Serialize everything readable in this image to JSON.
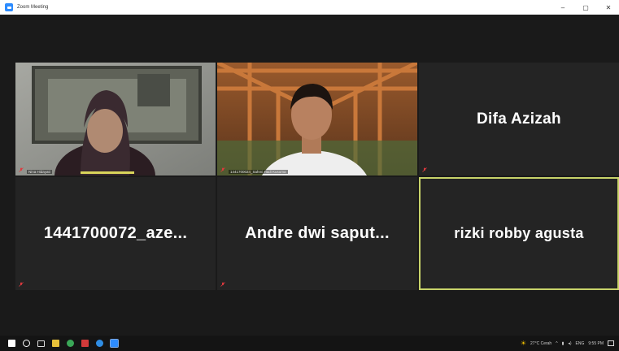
{
  "window": {
    "title": "Zoom Meeting",
    "controls": [
      "–",
      "▢",
      "✕"
    ]
  },
  "participants": [
    {
      "name": "",
      "caption": "Nina Hidayati",
      "video": true
    },
    {
      "name": "",
      "caption": "1441700024_Sahmi Hadi Kusuma",
      "video": true
    },
    {
      "name": "Difa Azizah",
      "caption": "",
      "video": false
    },
    {
      "name": "1441700072_aze...",
      "caption": "",
      "video": false
    },
    {
      "name": "Andre dwi saput...",
      "caption": "",
      "video": false
    },
    {
      "name": "rizki robby agusta",
      "caption": "",
      "video": false,
      "active_speaker": true
    }
  ],
  "taskbar": {
    "weather": "27°C Cerah",
    "language": "ENG",
    "time": "9:55 PM"
  },
  "colors": {
    "active_border": "#c8d36a",
    "tile_bg": "#242424",
    "mute_icon": "#e0393e"
  }
}
